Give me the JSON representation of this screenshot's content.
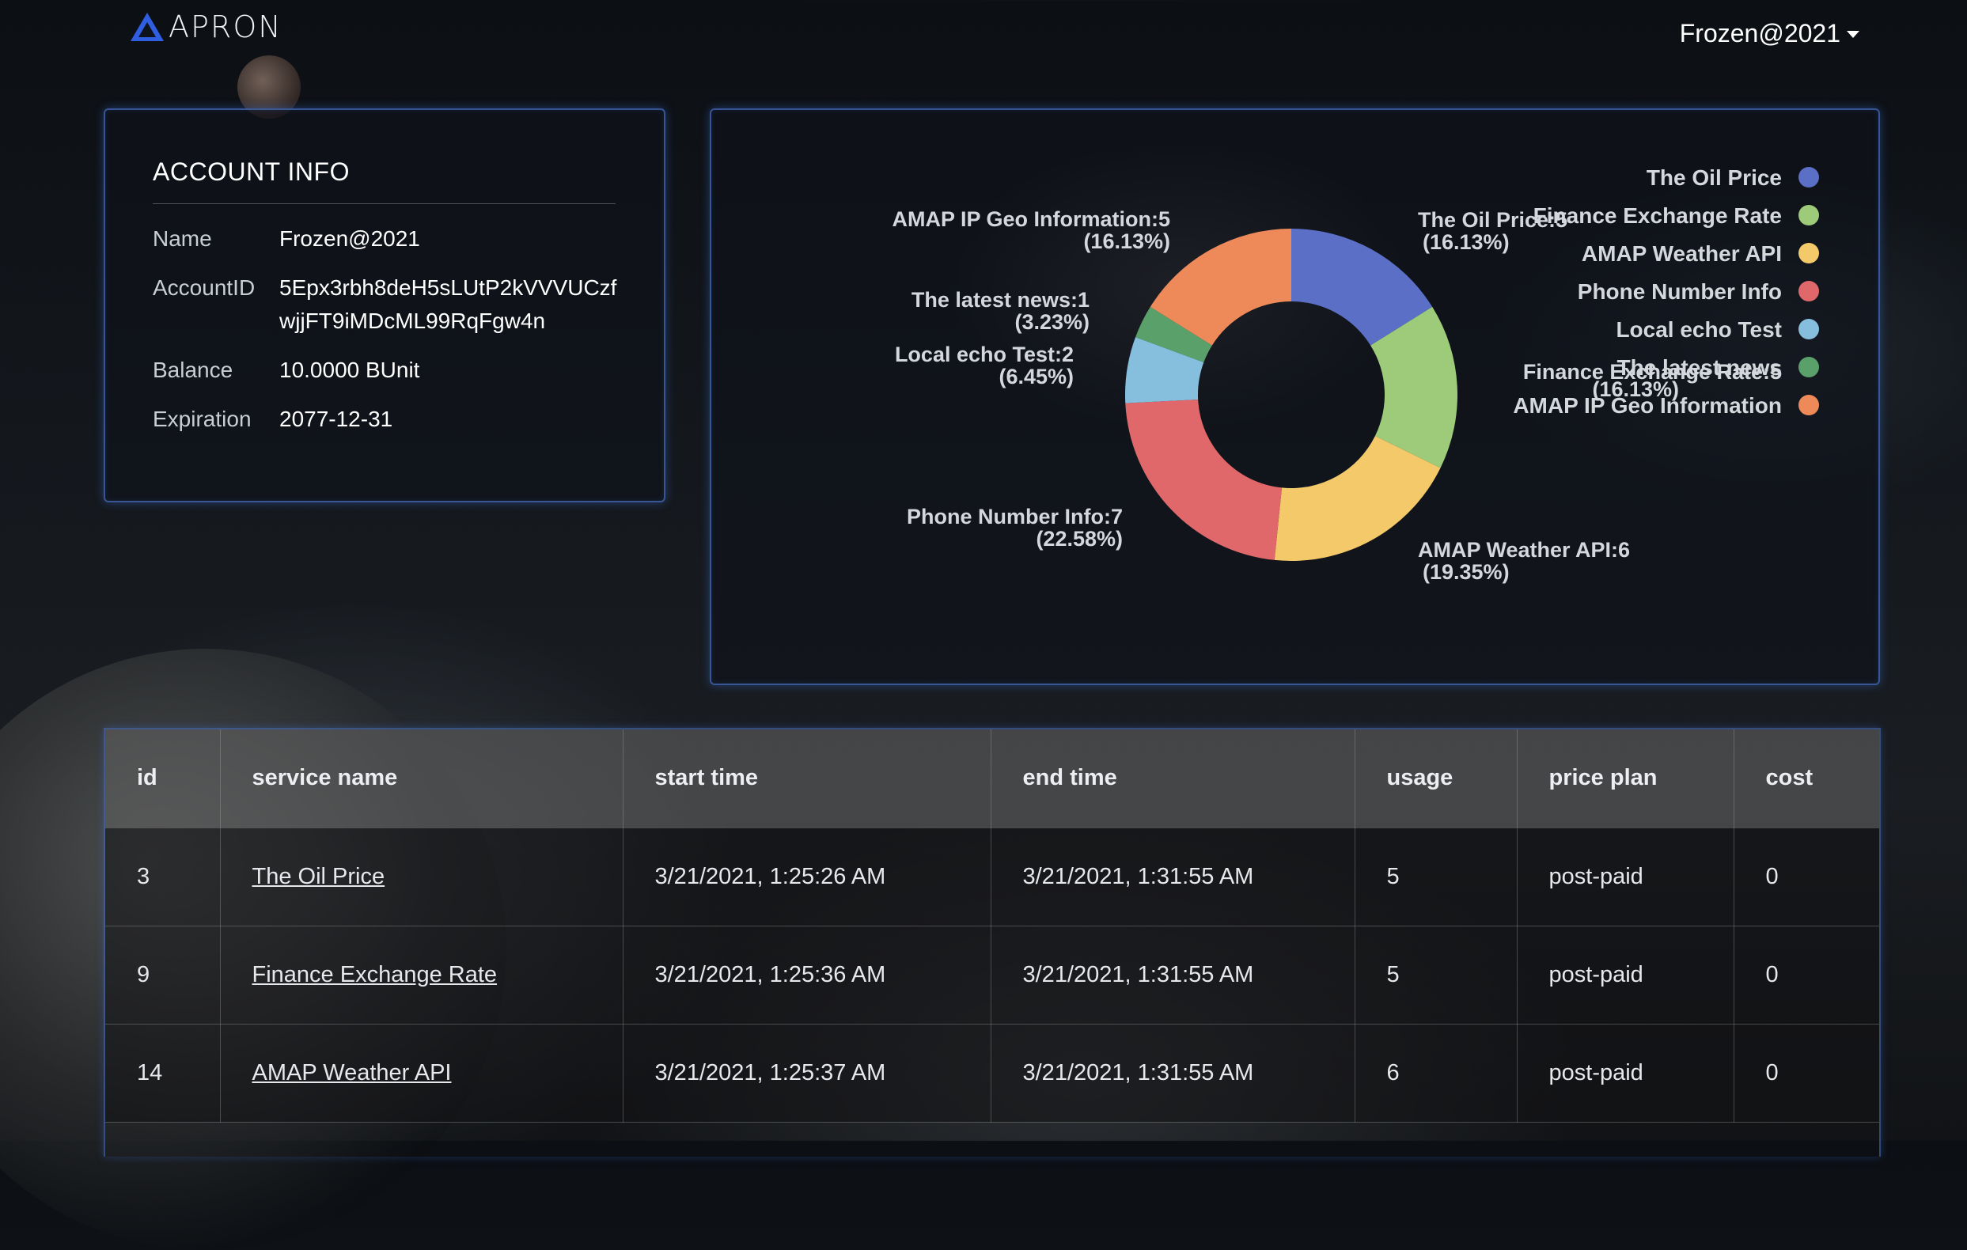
{
  "header": {
    "brand": "APRON",
    "user": "Frozen@2021"
  },
  "account": {
    "title": "ACCOUNT INFO",
    "rows": [
      {
        "label": "Name",
        "value": "Frozen@2021"
      },
      {
        "label": "AccountID",
        "value": "5Epx3rbh8deH5sLUtP2kVVVUCzfwjjFT9iMDcML99RqFgw4n"
      },
      {
        "label": "Balance",
        "value": "10.0000 BUnit"
      },
      {
        "label": "Expiration",
        "value": "2077-12-31"
      }
    ]
  },
  "chart_data": {
    "type": "pie",
    "categories": [
      "The Oil Price",
      "Finance Exchange Rate",
      "AMAP Weather API",
      "Phone Number Info",
      "Local echo Test",
      "The latest news",
      "AMAP IP Geo Information"
    ],
    "values": [
      5,
      5,
      6,
      7,
      2,
      1,
      5
    ],
    "labels": [
      {
        "name": "The Oil Price:5",
        "pct": "(16.13%)"
      },
      {
        "name": "Finance Exchange Rate:5",
        "pct": "(16.13%)"
      },
      {
        "name": "AMAP Weather API:6",
        "pct": "(19.35%)"
      },
      {
        "name": "Phone Number Info:7",
        "pct": "(22.58%)"
      },
      {
        "name": "Local echo Test:2",
        "pct": "(6.45%)"
      },
      {
        "name": "The latest news:1",
        "pct": "(3.23%)"
      },
      {
        "name": "AMAP IP Geo Information:5",
        "pct": "(16.13%)"
      }
    ],
    "colors": [
      "#5b6fc6",
      "#9dcb7a",
      "#f3c96a",
      "#e0686a",
      "#86bfde",
      "#5aa06a",
      "#ee8a5a"
    ],
    "legend_position": "top-right"
  },
  "table": {
    "headers": [
      "id",
      "service name",
      "start time",
      "end time",
      "usage",
      "price plan",
      "cost"
    ],
    "rows": [
      {
        "id": "3",
        "service": "The Oil Price",
        "start": "3/21/2021, 1:25:26 AM",
        "end": "3/21/2021, 1:31:55 AM",
        "usage": "5",
        "plan": "post-paid",
        "cost": "0"
      },
      {
        "id": "9",
        "service": "Finance Exchange Rate",
        "start": "3/21/2021, 1:25:36 AM",
        "end": "3/21/2021, 1:31:55 AM",
        "usage": "5",
        "plan": "post-paid",
        "cost": "0"
      },
      {
        "id": "14",
        "service": "AMAP Weather API",
        "start": "3/21/2021, 1:25:37 AM",
        "end": "3/21/2021, 1:31:55 AM",
        "usage": "6",
        "plan": "post-paid",
        "cost": "0"
      }
    ]
  }
}
